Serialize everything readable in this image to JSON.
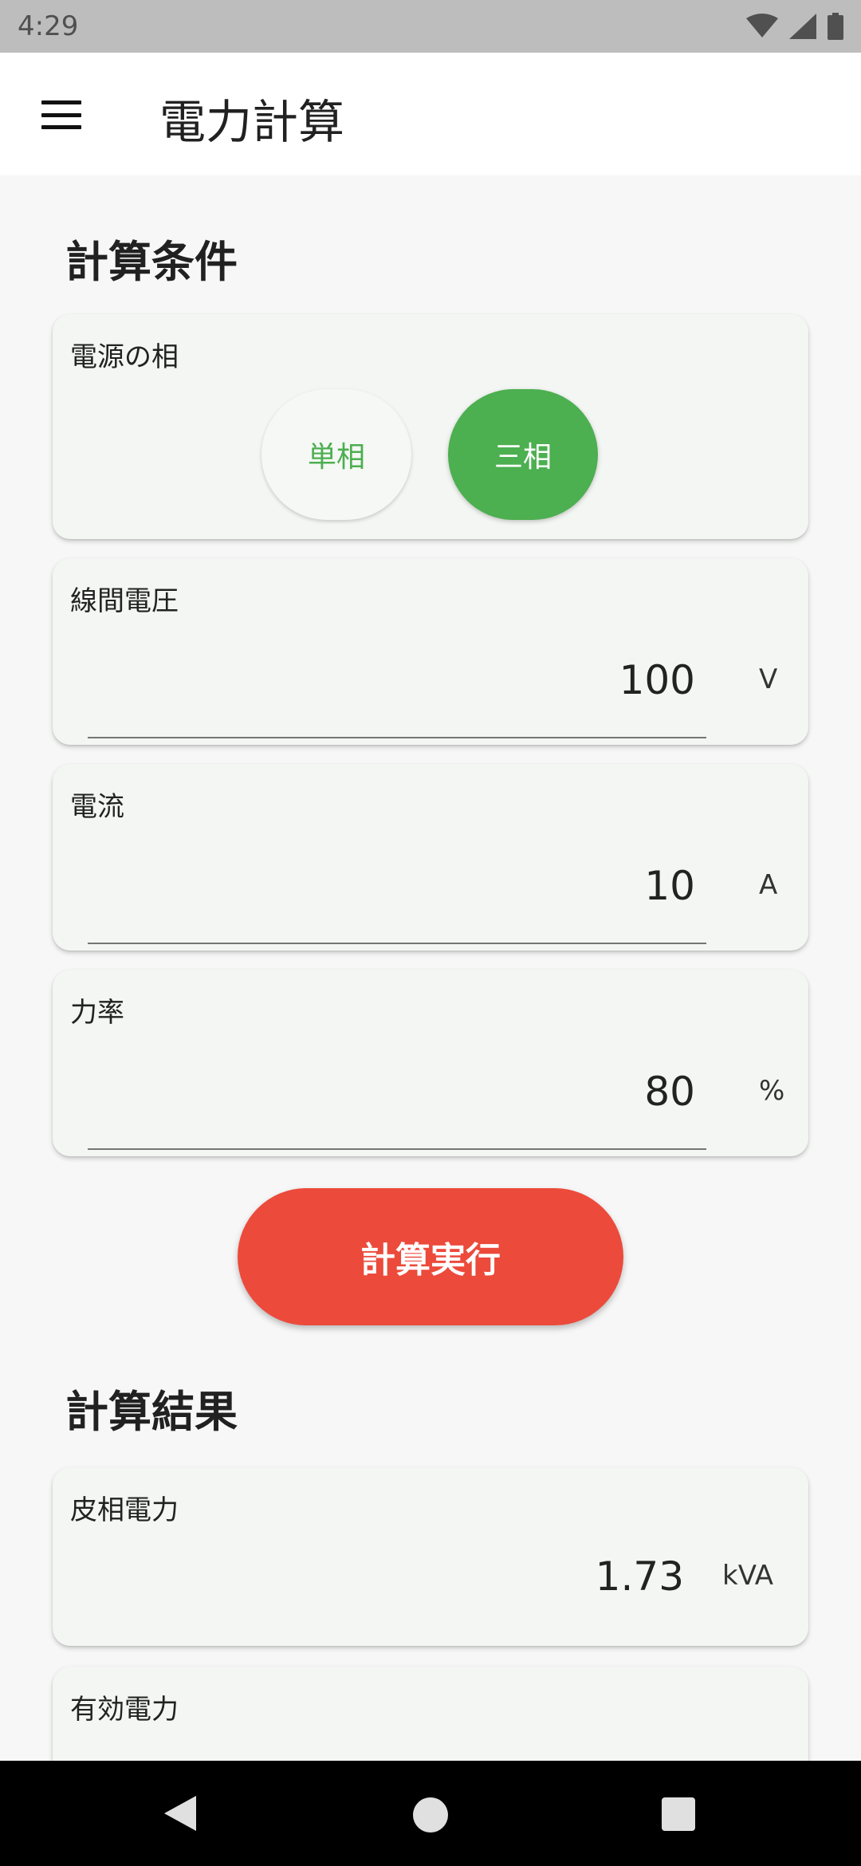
{
  "status_bar": {
    "time": "4:29",
    "icons": [
      "wifi-icon",
      "cell-signal-icon",
      "battery-icon"
    ]
  },
  "app_bar": {
    "title": "電力計算",
    "menu_icon": "hamburger-menu-icon"
  },
  "conditions": {
    "title": "計算条件",
    "phase": {
      "label": "電源の相",
      "options": [
        "単相",
        "三相"
      ],
      "selected": "三相"
    },
    "voltage": {
      "label": "線間電圧",
      "value": "100",
      "unit": "V"
    },
    "current": {
      "label": "電流",
      "value": "10",
      "unit": "A"
    },
    "power_factor": {
      "label": "力率",
      "value": "80",
      "unit": "%"
    }
  },
  "execute_button": {
    "label": "計算実行"
  },
  "results": {
    "title": "計算結果",
    "apparent_power": {
      "label": "皮相電力",
      "value": "1.73",
      "unit": "kVA"
    },
    "active_power": {
      "label": "有効電力"
    }
  },
  "colors": {
    "accent_green": "#4caf50",
    "button_red": "#ec4a3b",
    "status_bar": "#bdbdbd",
    "card_bg": "#f3f6f3"
  }
}
